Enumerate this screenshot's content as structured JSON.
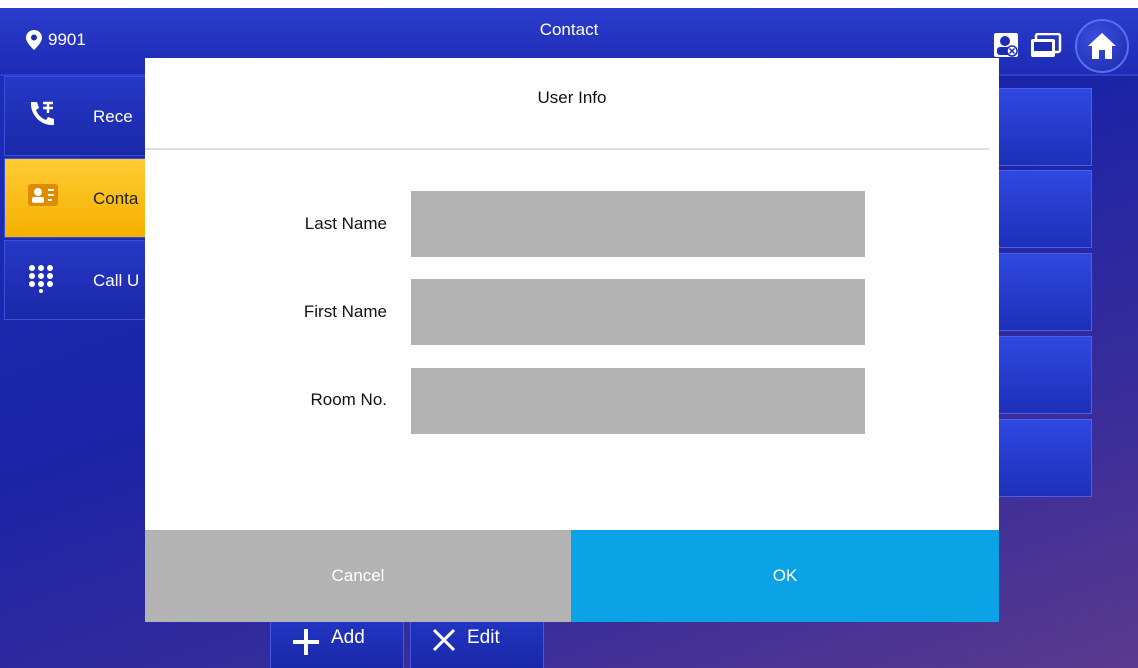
{
  "topbar": {
    "location": "9901",
    "title": "Contact"
  },
  "sidebar": {
    "items": [
      {
        "label": "Rece",
        "icon": "call-record-icon"
      },
      {
        "label": "Conta",
        "icon": "contact-card-icon"
      },
      {
        "label": "Call U",
        "icon": "keypad-icon"
      }
    ]
  },
  "bottom": {
    "add_label": "Add",
    "edit_label": "Edit"
  },
  "modal": {
    "title": "User Info",
    "fields": [
      {
        "label": "Last Name",
        "value": ""
      },
      {
        "label": "First Name",
        "value": ""
      },
      {
        "label": "Room No.",
        "value": ""
      }
    ],
    "cancel_label": "Cancel",
    "ok_label": "OK"
  },
  "colors": {
    "accent": "#0aa3e6",
    "active_yellow": "#f5b000",
    "input_gray": "#b3b3b3"
  }
}
